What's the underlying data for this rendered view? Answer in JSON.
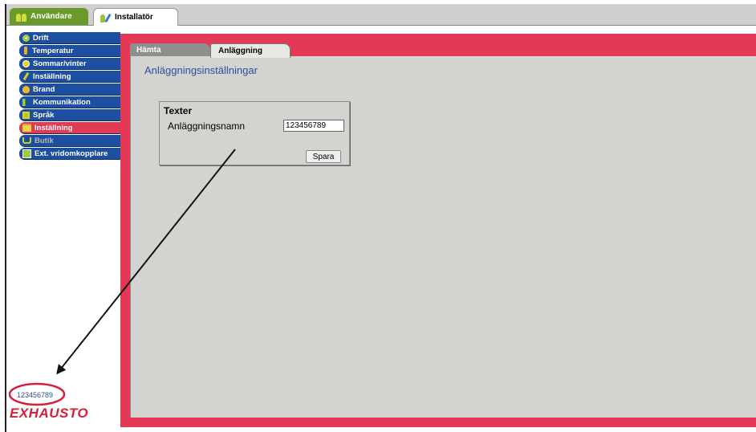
{
  "top_tabs": [
    {
      "label": "Användare",
      "icon": "users-icon"
    },
    {
      "label": "Installatör",
      "icon": "installer-icon"
    }
  ],
  "sidebar": {
    "items": [
      {
        "label": "Drift",
        "icon": "fan-icon"
      },
      {
        "label": "Temperatur",
        "icon": "thermometer-icon"
      },
      {
        "label": "Sommar/vinter",
        "icon": "sun-icon"
      },
      {
        "label": "Inställning",
        "icon": "pen-icon"
      },
      {
        "label": "Brand",
        "icon": "fire-icon"
      },
      {
        "label": "Kommunikation",
        "icon": "communication-icon"
      },
      {
        "label": "Språk",
        "icon": "language-icon"
      },
      {
        "label": "Inställning",
        "icon": "folder-icon",
        "state": "active"
      },
      {
        "label": "Butik",
        "icon": "cart-icon",
        "state": "disabled"
      },
      {
        "label": "Ext. vridomkopplare",
        "icon": "switch-icon"
      }
    ]
  },
  "content_tabs": [
    {
      "label": "Hämta"
    },
    {
      "label": "Anläggning",
      "state": "active"
    }
  ],
  "page_title": "Anläggningsinställningar",
  "texter_box": {
    "title": "Texter",
    "field_label": "Anläggningsnamn",
    "field_value": "123456789",
    "save_label": "Spara"
  },
  "bottom_left": {
    "name_value": "123456789",
    "logo": "EXHAUSTO"
  },
  "colors": {
    "nav_blue": "#1d4fa0",
    "accent_red": "#e43956",
    "panel_gray": "#d3d3cf",
    "annotation_red": "#d6203a"
  }
}
